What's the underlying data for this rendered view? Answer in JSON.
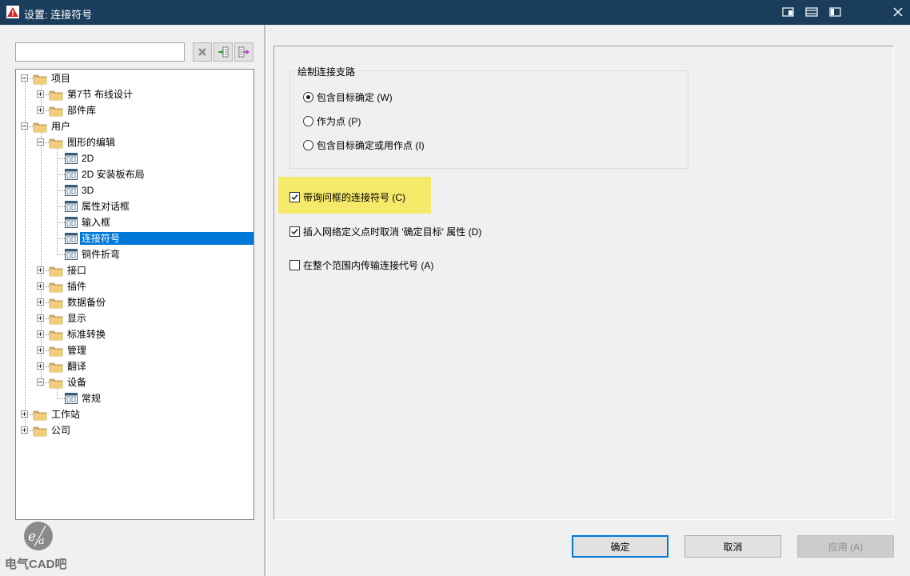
{
  "window": {
    "title": "设置: 连接符号",
    "colors": {
      "titlebar": "#1a3d5c",
      "selection": "#0078d7",
      "highlight": "#f5e96a"
    }
  },
  "search": {
    "value": "",
    "placeholder": ""
  },
  "tree": {
    "nodes": [
      {
        "label": "项目",
        "level": 0,
        "type": "folder",
        "expanded": true
      },
      {
        "label": "第7节 布线设计",
        "level": 1,
        "type": "folder",
        "expanded": false
      },
      {
        "label": "部件库",
        "level": 1,
        "type": "folder",
        "expanded": false
      },
      {
        "label": "用户",
        "level": 0,
        "type": "folder",
        "expanded": true
      },
      {
        "label": "图形的编辑",
        "level": 1,
        "type": "folder",
        "expanded": true
      },
      {
        "label": "2D",
        "level": 2,
        "type": "page"
      },
      {
        "label": "2D 安装板布局",
        "level": 2,
        "type": "page"
      },
      {
        "label": "3D",
        "level": 2,
        "type": "page"
      },
      {
        "label": "属性对话框",
        "level": 2,
        "type": "page"
      },
      {
        "label": "输入框",
        "level": 2,
        "type": "page"
      },
      {
        "label": "连接符号",
        "level": 2,
        "type": "page",
        "selected": true
      },
      {
        "label": "铜件折弯",
        "level": 2,
        "type": "page"
      },
      {
        "label": "接口",
        "level": 1,
        "type": "folder",
        "expanded": false
      },
      {
        "label": "插件",
        "level": 1,
        "type": "folder",
        "expanded": false
      },
      {
        "label": "数据备份",
        "level": 1,
        "type": "folder",
        "expanded": false
      },
      {
        "label": "显示",
        "level": 1,
        "type": "folder",
        "expanded": false
      },
      {
        "label": "标准转换",
        "level": 1,
        "type": "folder",
        "expanded": false
      },
      {
        "label": "管理",
        "level": 1,
        "type": "folder",
        "expanded": false
      },
      {
        "label": "翻译",
        "level": 1,
        "type": "folder",
        "expanded": false
      },
      {
        "label": "设备",
        "level": 1,
        "type": "folder",
        "expanded": true
      },
      {
        "label": "常规",
        "level": 2,
        "type": "page"
      },
      {
        "label": "工作站",
        "level": 0,
        "type": "folder",
        "expanded": false
      },
      {
        "label": "公司",
        "level": 0,
        "type": "folder",
        "expanded": false
      }
    ]
  },
  "settings": {
    "group_title": "绘制连接支路",
    "radios": [
      {
        "label": "包含目标确定 (W)",
        "checked": true
      },
      {
        "label": "作为点 (P)",
        "checked": false
      },
      {
        "label": "包含目标确定或用作点 (I)",
        "checked": false
      }
    ],
    "checkboxes": [
      {
        "label": "带询问框的连接符号 (C)",
        "checked": true
      },
      {
        "label": "插入网络定义点时取消 '确定目标' 属性 (D)",
        "checked": true
      },
      {
        "label": "在整个范围内传输连接代号 (A)",
        "checked": false
      }
    ]
  },
  "buttons": {
    "ok": "确定",
    "cancel": "取消",
    "apply": "应用 (A)"
  },
  "watermark": {
    "text": "电气CAD吧"
  }
}
